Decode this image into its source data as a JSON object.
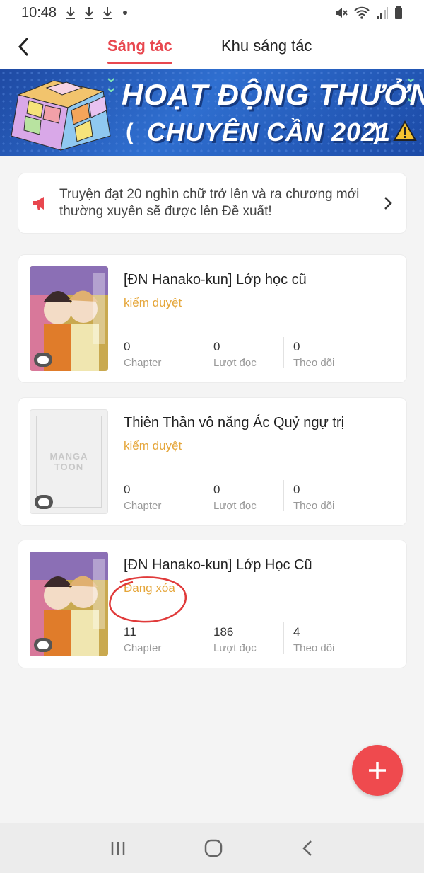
{
  "status_bar": {
    "time": "10:48"
  },
  "header": {
    "tabs": [
      {
        "label": "Sáng tác",
        "active": true
      },
      {
        "label": "Khu sáng tác",
        "active": false
      }
    ]
  },
  "banner": {
    "line1": "HOẠT ĐỘNG THƯỞNG",
    "line2": "CHUYÊN CẦN 2021"
  },
  "notice": {
    "text": "Truyện đạt 20 nghìn chữ trở lên và ra chương mới thường xuyên sẽ được lên Đề xuất!"
  },
  "stories": [
    {
      "title": "[ĐN Hanako-kun] Lớp học cũ",
      "status": "kiểm duyệt",
      "stats": [
        {
          "value": "0",
          "label": "Chapter"
        },
        {
          "value": "0",
          "label": "Lượt đọc"
        },
        {
          "value": "0",
          "label": "Theo dõi"
        }
      ]
    },
    {
      "title": "Thiên Thần vô năng Ác Quỷ ngự trị",
      "status": "kiểm duyệt",
      "placeholder_text_1": "MANGA",
      "placeholder_text_2": "TOON",
      "stats": [
        {
          "value": "0",
          "label": "Chapter"
        },
        {
          "value": "0",
          "label": "Lượt đọc"
        },
        {
          "value": "0",
          "label": "Theo dõi"
        }
      ]
    },
    {
      "title": "[ĐN Hanako-kun] Lớp Học Cũ",
      "status": "Đang xóa",
      "stats": [
        {
          "value": "11",
          "label": "Chapter"
        },
        {
          "value": "186",
          "label": "Lượt đọc"
        },
        {
          "value": "4",
          "label": "Theo dõi"
        }
      ]
    }
  ],
  "colors": {
    "accent": "#e8474f",
    "status_yellow": "#e5a63a",
    "fab": "#ef4a4e"
  }
}
